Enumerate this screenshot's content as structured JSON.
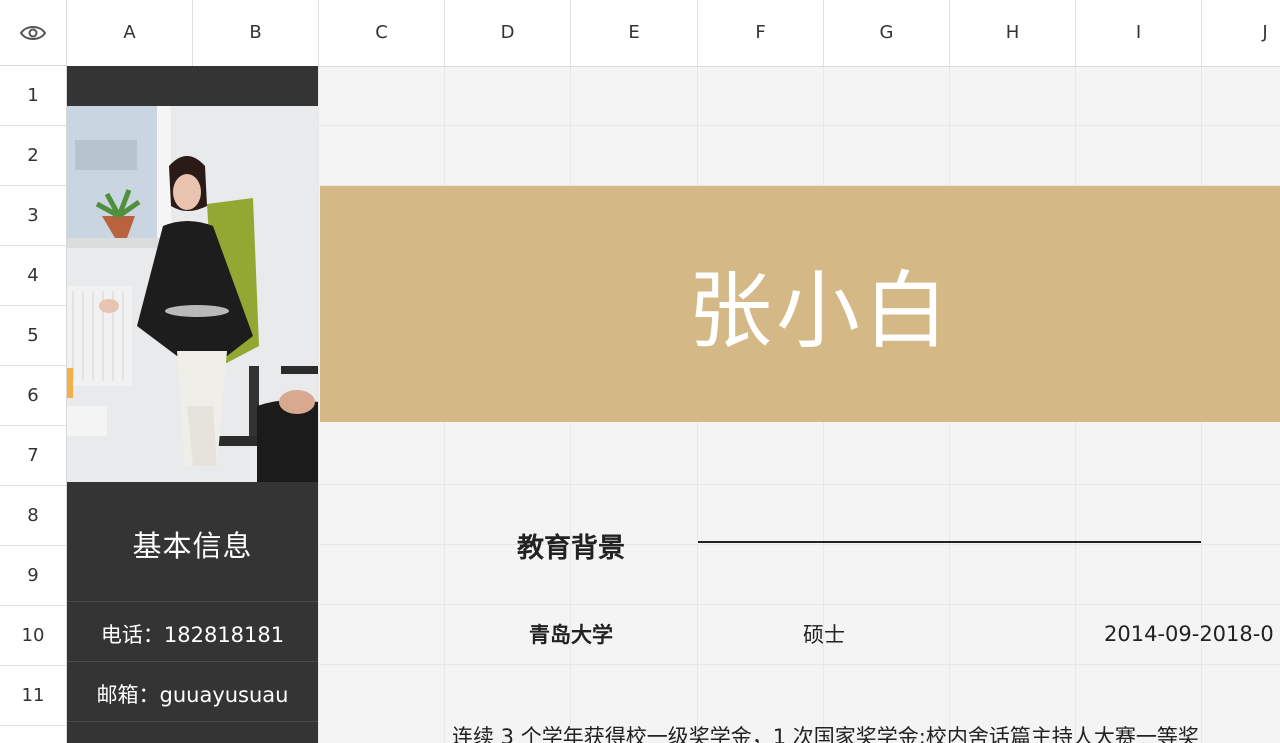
{
  "columns": [
    "A",
    "B",
    "C",
    "D",
    "E",
    "F",
    "G",
    "H",
    "I",
    "J"
  ],
  "rows": [
    "1",
    "2",
    "3",
    "4",
    "5",
    "6",
    "7",
    "8",
    "9",
    "10",
    "11"
  ],
  "corner_icon": "eye-icon",
  "profile": {
    "name": "张小白",
    "basic_info_title": "基本信息",
    "phone": "电话：182818181",
    "email": "邮箱：guuayusuau"
  },
  "education": {
    "section_title": "教育背景",
    "school": "青岛大学",
    "degree": "硕士",
    "period": "2014-09-2018-0",
    "description": "连续 3 个学年获得校一级奖学金，1 次国家奖学金;校内舍话篇主持人大赛一等奖"
  },
  "colors": {
    "banner": "#d4b886",
    "sidebar": "#343434",
    "sheet_bg": "#f4f4f4"
  }
}
